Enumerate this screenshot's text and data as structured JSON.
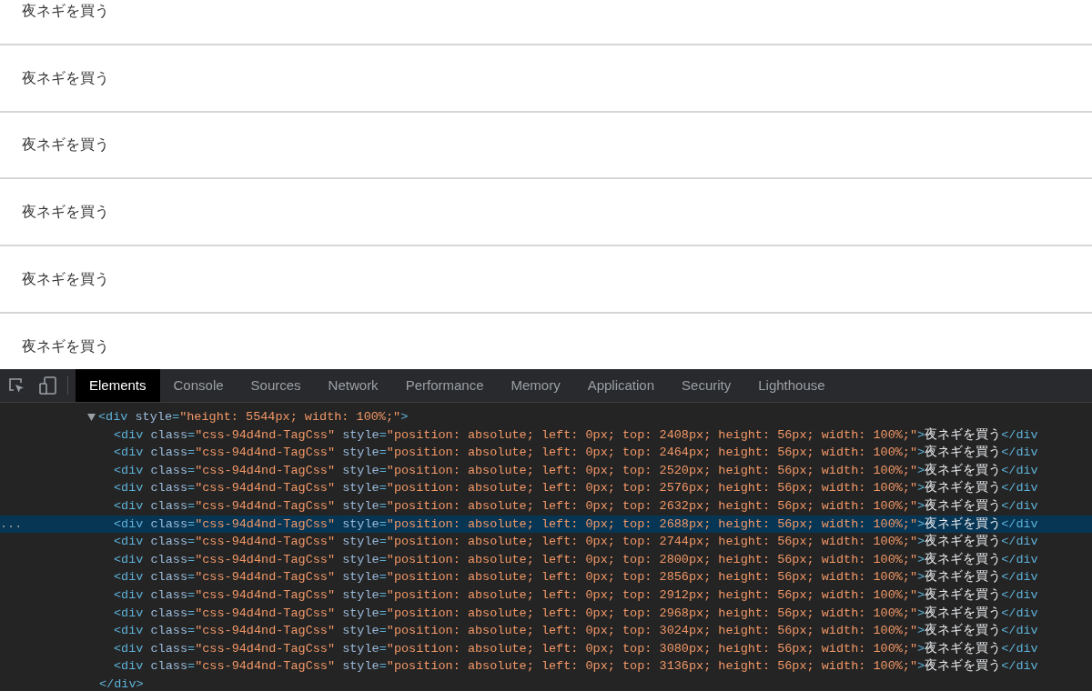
{
  "list_items": [
    {
      "label": "夜ネギを買う"
    },
    {
      "label": "夜ネギを買う"
    },
    {
      "label": "夜ネギを買う"
    },
    {
      "label": "夜ネギを買う"
    },
    {
      "label": "夜ネギを買う"
    },
    {
      "label": "夜ネギを買う"
    }
  ],
  "devtools": {
    "tabs": [
      {
        "label": "Elements",
        "selected": true
      },
      {
        "label": "Console",
        "selected": false
      },
      {
        "label": "Sources",
        "selected": false
      },
      {
        "label": "Network",
        "selected": false
      },
      {
        "label": "Performance",
        "selected": false
      },
      {
        "label": "Memory",
        "selected": false
      },
      {
        "label": "Application",
        "selected": false
      },
      {
        "label": "Security",
        "selected": false
      },
      {
        "label": "Lighthouse",
        "selected": false
      }
    ],
    "dom": {
      "expanded": true,
      "tokens": [
        {
          "kind": "tag",
          "text": "<div"
        },
        {
          "kind": "attr",
          "text": " style"
        },
        {
          "kind": "tag",
          "text": "="
        },
        {
          "kind": "value",
          "text": "\"height: 5544px; width: 100%;\""
        },
        {
          "kind": "tag",
          "text": ">"
        }
      ],
      "children": [
        {
          "selected": false,
          "tokens": [
            {
              "kind": "tag",
              "text": "<div"
            },
            {
              "kind": "attr",
              "text": " class"
            },
            {
              "kind": "tag",
              "text": "="
            },
            {
              "kind": "value",
              "text": "\"css-94d4nd-TagCss\""
            },
            {
              "kind": "attr",
              "text": " style"
            },
            {
              "kind": "tag",
              "text": "="
            },
            {
              "kind": "value",
              "text": "\"position: absolute; left: 0px; top: 2408px; height: 56px; width: 100%;\""
            },
            {
              "kind": "tag",
              "text": ">"
            },
            {
              "kind": "text",
              "text": "夜ネギを買う"
            },
            {
              "kind": "tag",
              "text": "</div"
            }
          ]
        },
        {
          "selected": false,
          "tokens": [
            {
              "kind": "tag",
              "text": "<div"
            },
            {
              "kind": "attr",
              "text": " class"
            },
            {
              "kind": "tag",
              "text": "="
            },
            {
              "kind": "value",
              "text": "\"css-94d4nd-TagCss\""
            },
            {
              "kind": "attr",
              "text": " style"
            },
            {
              "kind": "tag",
              "text": "="
            },
            {
              "kind": "value",
              "text": "\"position: absolute; left: 0px; top: 2464px; height: 56px; width: 100%;\""
            },
            {
              "kind": "tag",
              "text": ">"
            },
            {
              "kind": "text",
              "text": "夜ネギを買う"
            },
            {
              "kind": "tag",
              "text": "</div"
            }
          ]
        },
        {
          "selected": false,
          "tokens": [
            {
              "kind": "tag",
              "text": "<div"
            },
            {
              "kind": "attr",
              "text": " class"
            },
            {
              "kind": "tag",
              "text": "="
            },
            {
              "kind": "value",
              "text": "\"css-94d4nd-TagCss\""
            },
            {
              "kind": "attr",
              "text": " style"
            },
            {
              "kind": "tag",
              "text": "="
            },
            {
              "kind": "value",
              "text": "\"position: absolute; left: 0px; top: 2520px; height: 56px; width: 100%;\""
            },
            {
              "kind": "tag",
              "text": ">"
            },
            {
              "kind": "text",
              "text": "夜ネギを買う"
            },
            {
              "kind": "tag",
              "text": "</div"
            }
          ]
        },
        {
          "selected": false,
          "tokens": [
            {
              "kind": "tag",
              "text": "<div"
            },
            {
              "kind": "attr",
              "text": " class"
            },
            {
              "kind": "tag",
              "text": "="
            },
            {
              "kind": "value",
              "text": "\"css-94d4nd-TagCss\""
            },
            {
              "kind": "attr",
              "text": " style"
            },
            {
              "kind": "tag",
              "text": "="
            },
            {
              "kind": "value",
              "text": "\"position: absolute; left: 0px; top: 2576px; height: 56px; width: 100%;\""
            },
            {
              "kind": "tag",
              "text": ">"
            },
            {
              "kind": "text",
              "text": "夜ネギを買う"
            },
            {
              "kind": "tag",
              "text": "</div"
            }
          ]
        },
        {
          "selected": false,
          "tokens": [
            {
              "kind": "tag",
              "text": "<div"
            },
            {
              "kind": "attr",
              "text": " class"
            },
            {
              "kind": "tag",
              "text": "="
            },
            {
              "kind": "value",
              "text": "\"css-94d4nd-TagCss\""
            },
            {
              "kind": "attr",
              "text": " style"
            },
            {
              "kind": "tag",
              "text": "="
            },
            {
              "kind": "value",
              "text": "\"position: absolute; left: 0px; top: 2632px; height: 56px; width: 100%;\""
            },
            {
              "kind": "tag",
              "text": ">"
            },
            {
              "kind": "text",
              "text": "夜ネギを買う"
            },
            {
              "kind": "tag",
              "text": "</div"
            }
          ]
        },
        {
          "selected": true,
          "marker": "...",
          "tokens": [
            {
              "kind": "tag",
              "text": "<div"
            },
            {
              "kind": "attr",
              "text": " class"
            },
            {
              "kind": "tag",
              "text": "="
            },
            {
              "kind": "value",
              "text": "\"css-94d4nd-TagCss\""
            },
            {
              "kind": "attr",
              "text": " style"
            },
            {
              "kind": "tag",
              "text": "="
            },
            {
              "kind": "value",
              "text": "\"position: absolute; left: 0px; top: 2688px; height: 56px; width: 100%;\""
            },
            {
              "kind": "tag",
              "text": ">"
            },
            {
              "kind": "text",
              "text": "夜ネギを買う"
            },
            {
              "kind": "tag",
              "text": "</div"
            }
          ]
        },
        {
          "selected": false,
          "tokens": [
            {
              "kind": "tag",
              "text": "<div"
            },
            {
              "kind": "attr",
              "text": " class"
            },
            {
              "kind": "tag",
              "text": "="
            },
            {
              "kind": "value",
              "text": "\"css-94d4nd-TagCss\""
            },
            {
              "kind": "attr",
              "text": " style"
            },
            {
              "kind": "tag",
              "text": "="
            },
            {
              "kind": "value",
              "text": "\"position: absolute; left: 0px; top: 2744px; height: 56px; width: 100%;\""
            },
            {
              "kind": "tag",
              "text": ">"
            },
            {
              "kind": "text",
              "text": "夜ネギを買う"
            },
            {
              "kind": "tag",
              "text": "</div"
            }
          ]
        },
        {
          "selected": false,
          "tokens": [
            {
              "kind": "tag",
              "text": "<div"
            },
            {
              "kind": "attr",
              "text": " class"
            },
            {
              "kind": "tag",
              "text": "="
            },
            {
              "kind": "value",
              "text": "\"css-94d4nd-TagCss\""
            },
            {
              "kind": "attr",
              "text": " style"
            },
            {
              "kind": "tag",
              "text": "="
            },
            {
              "kind": "value",
              "text": "\"position: absolute; left: 0px; top: 2800px; height: 56px; width: 100%;\""
            },
            {
              "kind": "tag",
              "text": ">"
            },
            {
              "kind": "text",
              "text": "夜ネギを買う"
            },
            {
              "kind": "tag",
              "text": "</div"
            }
          ]
        },
        {
          "selected": false,
          "tokens": [
            {
              "kind": "tag",
              "text": "<div"
            },
            {
              "kind": "attr",
              "text": " class"
            },
            {
              "kind": "tag",
              "text": "="
            },
            {
              "kind": "value",
              "text": "\"css-94d4nd-TagCss\""
            },
            {
              "kind": "attr",
              "text": " style"
            },
            {
              "kind": "tag",
              "text": "="
            },
            {
              "kind": "value",
              "text": "\"position: absolute; left: 0px; top: 2856px; height: 56px; width: 100%;\""
            },
            {
              "kind": "tag",
              "text": ">"
            },
            {
              "kind": "text",
              "text": "夜ネギを買う"
            },
            {
              "kind": "tag",
              "text": "</div"
            }
          ]
        },
        {
          "selected": false,
          "tokens": [
            {
              "kind": "tag",
              "text": "<div"
            },
            {
              "kind": "attr",
              "text": " class"
            },
            {
              "kind": "tag",
              "text": "="
            },
            {
              "kind": "value",
              "text": "\"css-94d4nd-TagCss\""
            },
            {
              "kind": "attr",
              "text": " style"
            },
            {
              "kind": "tag",
              "text": "="
            },
            {
              "kind": "value",
              "text": "\"position: absolute; left: 0px; top: 2912px; height: 56px; width: 100%;\""
            },
            {
              "kind": "tag",
              "text": ">"
            },
            {
              "kind": "text",
              "text": "夜ネギを買う"
            },
            {
              "kind": "tag",
              "text": "</div"
            }
          ]
        },
        {
          "selected": false,
          "tokens": [
            {
              "kind": "tag",
              "text": "<div"
            },
            {
              "kind": "attr",
              "text": " class"
            },
            {
              "kind": "tag",
              "text": "="
            },
            {
              "kind": "value",
              "text": "\"css-94d4nd-TagCss\""
            },
            {
              "kind": "attr",
              "text": " style"
            },
            {
              "kind": "tag",
              "text": "="
            },
            {
              "kind": "value",
              "text": "\"position: absolute; left: 0px; top: 2968px; height: 56px; width: 100%;\""
            },
            {
              "kind": "tag",
              "text": ">"
            },
            {
              "kind": "text",
              "text": "夜ネギを買う"
            },
            {
              "kind": "tag",
              "text": "</div"
            }
          ]
        },
        {
          "selected": false,
          "tokens": [
            {
              "kind": "tag",
              "text": "<div"
            },
            {
              "kind": "attr",
              "text": " class"
            },
            {
              "kind": "tag",
              "text": "="
            },
            {
              "kind": "value",
              "text": "\"css-94d4nd-TagCss\""
            },
            {
              "kind": "attr",
              "text": " style"
            },
            {
              "kind": "tag",
              "text": "="
            },
            {
              "kind": "value",
              "text": "\"position: absolute; left: 0px; top: 3024px; height: 56px; width: 100%;\""
            },
            {
              "kind": "tag",
              "text": ">"
            },
            {
              "kind": "text",
              "text": "夜ネギを買う"
            },
            {
              "kind": "tag",
              "text": "</div"
            }
          ]
        },
        {
          "selected": false,
          "tokens": [
            {
              "kind": "tag",
              "text": "<div"
            },
            {
              "kind": "attr",
              "text": " class"
            },
            {
              "kind": "tag",
              "text": "="
            },
            {
              "kind": "value",
              "text": "\"css-94d4nd-TagCss\""
            },
            {
              "kind": "attr",
              "text": " style"
            },
            {
              "kind": "tag",
              "text": "="
            },
            {
              "kind": "value",
              "text": "\"position: absolute; left: 0px; top: 3080px; height: 56px; width: 100%;\""
            },
            {
              "kind": "tag",
              "text": ">"
            },
            {
              "kind": "text",
              "text": "夜ネギを買う"
            },
            {
              "kind": "tag",
              "text": "</div"
            }
          ]
        },
        {
          "selected": false,
          "tokens": [
            {
              "kind": "tag",
              "text": "<div"
            },
            {
              "kind": "attr",
              "text": " class"
            },
            {
              "kind": "tag",
              "text": "="
            },
            {
              "kind": "value",
              "text": "\"css-94d4nd-TagCss\""
            },
            {
              "kind": "attr",
              "text": " style"
            },
            {
              "kind": "tag",
              "text": "="
            },
            {
              "kind": "value",
              "text": "\"position: absolute; left: 0px; top: 3136px; height: 56px; width: 100%;\""
            },
            {
              "kind": "tag",
              "text": ">"
            },
            {
              "kind": "text",
              "text": "夜ネギを買う"
            },
            {
              "kind": "tag",
              "text": "</div"
            }
          ]
        }
      ],
      "closing_tokens": [
        {
          "kind": "tag",
          "text": "</div>"
        }
      ]
    }
  }
}
